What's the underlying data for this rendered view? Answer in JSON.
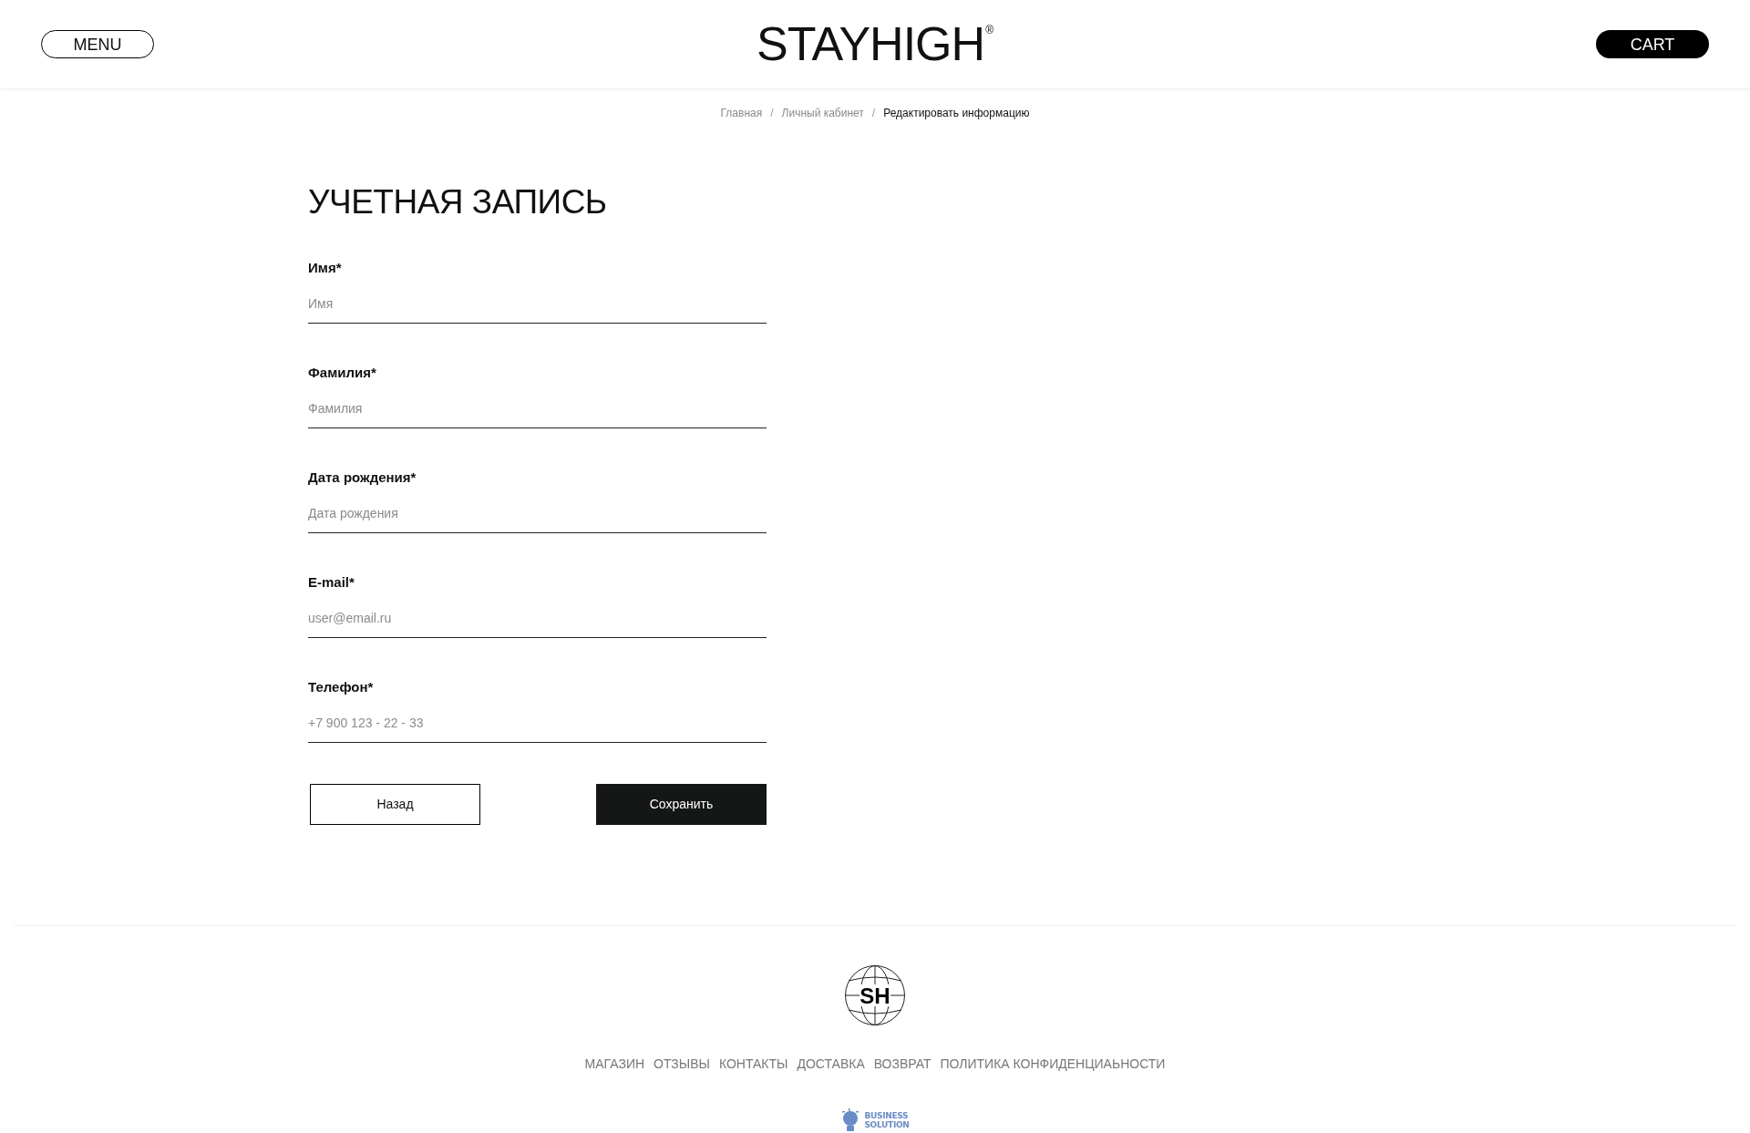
{
  "header": {
    "menu_button": "MENU",
    "logo": "STAYHIGH",
    "logo_mark": "®",
    "cart_button": "CART"
  },
  "breadcrumbs": [
    {
      "label": "Главная",
      "current": false
    },
    {
      "label": "Личный кабинет",
      "current": false
    },
    {
      "label": "Редактировать информацию",
      "current": true
    }
  ],
  "breadcrumb_separator": "/",
  "title": "УЧЕТНАЯ ЗАПИСЬ",
  "fields": [
    {
      "label": "Имя*",
      "placeholder": "Имя"
    },
    {
      "label": "Фамилия*",
      "placeholder": "Фамилия"
    },
    {
      "label": "Дата рождения*",
      "placeholder": "Дата рождения"
    },
    {
      "label": "E-mail*",
      "placeholder": "user@email.ru"
    },
    {
      "label": "Телефон*",
      "placeholder": "+7 900 123 - 22 - 33"
    }
  ],
  "buttons": [
    {
      "label": "Назад",
      "kind": "secondary"
    },
    {
      "label": "Сохранить",
      "kind": "primary"
    }
  ],
  "footer": {
    "logo_text": "SH",
    "links": [
      "МАГАЗИН",
      "ОТЗЫВЫ",
      "КОНТАКТЫ",
      "ДОСТАВКА",
      "ВОЗВРАТ",
      "ПОЛИТИКА КОНФИДЕНЦИАЬНОСТИ"
    ],
    "developer_logo": [
      "BUSINESS",
      "SOLUTION"
    ]
  }
}
